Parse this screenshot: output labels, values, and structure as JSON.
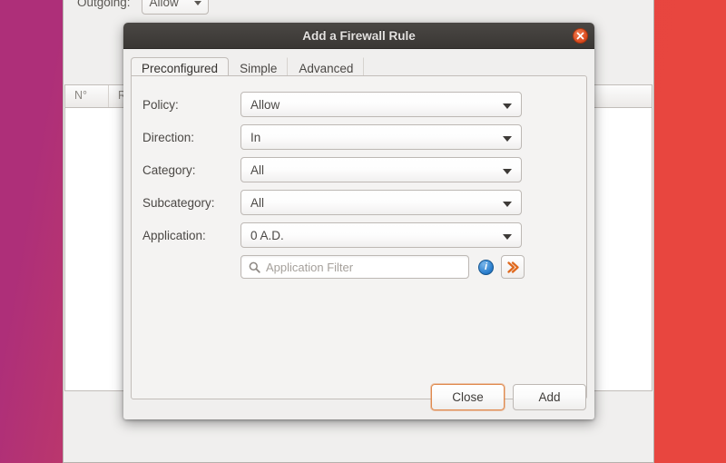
{
  "desktop": {
    "background_left_color": "#ae2f79",
    "background_right_color": "#e8463f"
  },
  "background_window": {
    "app_icon": "shield-icon",
    "outgoing_label": "Outgoing:",
    "outgoing_value": "Allow",
    "top_combo_value": "",
    "table": {
      "columns": [
        "N°",
        "R",
        ""
      ]
    }
  },
  "dialog": {
    "title": "Add a Firewall Rule",
    "close_icon": "close-icon",
    "tabs": [
      {
        "label": "Preconfigured",
        "active": true
      },
      {
        "label": "Simple",
        "active": false
      },
      {
        "label": "Advanced",
        "active": false
      }
    ],
    "fields": [
      {
        "label": "Policy:",
        "value": "Allow"
      },
      {
        "label": "Direction:",
        "value": "In"
      },
      {
        "label": "Category:",
        "value": "All"
      },
      {
        "label": "Subcategory:",
        "value": "All"
      },
      {
        "label": "Application:",
        "value": "0 A.D."
      }
    ],
    "filter": {
      "placeholder": "Application Filter",
      "value": "",
      "search_icon": "search-icon",
      "info_icon": "info-icon",
      "forward_icon": "double-chevron-right-icon"
    },
    "buttons": {
      "close_label": "Close",
      "add_label": "Add"
    },
    "accent_color": "#e08a4e"
  }
}
